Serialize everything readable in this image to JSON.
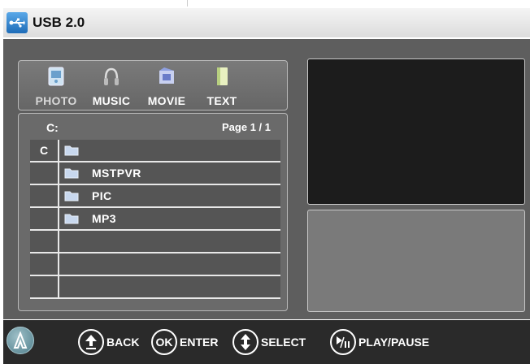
{
  "title": "USB 2.0",
  "categories": [
    {
      "label": "PHOTO",
      "icon": "photo-icon",
      "selected": true
    },
    {
      "label": "MUSIC",
      "icon": "music-icon",
      "selected": false
    },
    {
      "label": "MOVIE",
      "icon": "movie-icon",
      "selected": false
    },
    {
      "label": "TEXT",
      "icon": "text-icon",
      "selected": false
    }
  ],
  "browser": {
    "path": "C:",
    "page": "Page 1 / 1",
    "rows": [
      {
        "drive": "C",
        "name": "",
        "folder": true
      },
      {
        "drive": "",
        "name": "MSTPVR",
        "folder": true
      },
      {
        "drive": "",
        "name": "PIC",
        "folder": true
      },
      {
        "drive": "",
        "name": "MP3",
        "folder": true
      },
      {
        "drive": "",
        "name": "",
        "folder": false
      },
      {
        "drive": "",
        "name": "",
        "folder": false
      },
      {
        "drive": "",
        "name": "",
        "folder": false
      }
    ]
  },
  "hints": [
    {
      "key": "up-arrow",
      "label": "BACK"
    },
    {
      "key": "OK",
      "label": "ENTER"
    },
    {
      "key": "up-down-arrow",
      "label": "SELECT"
    },
    {
      "key": "play-pause",
      "label": "PLAY/PAUSE"
    }
  ]
}
